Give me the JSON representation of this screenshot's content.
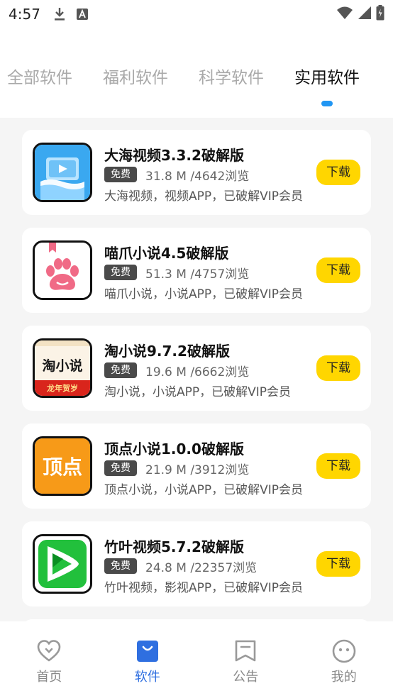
{
  "status_bar": {
    "time": "4:57"
  },
  "tabs": [
    {
      "label": "全部软件"
    },
    {
      "label": "福利软件"
    },
    {
      "label": "科学软件"
    },
    {
      "label": "实用软件"
    }
  ],
  "apps": [
    {
      "name": "大海视频3.3.2破解版",
      "badge": "免费",
      "meta": "31.8 M /4642浏览",
      "desc": "大海视频，视频APP，已破解VIP会员",
      "button": "下载"
    },
    {
      "name": "喵爪小说4.5破解版",
      "badge": "免费",
      "meta": "51.3 M /4757浏览",
      "desc": "喵爪小说，小说APP，已破解VIP会员",
      "button": "下载"
    },
    {
      "name": "淘小说9.7.2破解版",
      "badge": "免费",
      "meta": "19.6 M /6662浏览",
      "desc": "淘小说，小说APP，已破解VIP会员",
      "button": "下载",
      "icon_text": "淘小说",
      "icon_subtext": "龙年贺岁"
    },
    {
      "name": "顶点小说1.0.0破解版",
      "badge": "免费",
      "meta": "21.9 M /3912浏览",
      "desc": "顶点小说，小说APP，已破解VIP会员",
      "button": "下载",
      "icon_text": "顶点"
    },
    {
      "name": "竹叶视频5.7.2破解版",
      "badge": "免费",
      "meta": "24.8 M /22357浏览",
      "desc": "竹叶视频，影视APP，已破解VIP会员",
      "button": "下载"
    }
  ],
  "bottom_nav": [
    {
      "label": "首页",
      "icon": "heart-icon"
    },
    {
      "label": "软件",
      "icon": "shopping-bag-icon"
    },
    {
      "label": "公告",
      "icon": "bookmark-icon"
    },
    {
      "label": "我的",
      "icon": "smiley-icon"
    }
  ],
  "colors": {
    "tab_indicator": "#2196f3",
    "download_button": "#ffd600",
    "nav_active": "#2f6fe0",
    "list_background": "#f5f5f5"
  }
}
